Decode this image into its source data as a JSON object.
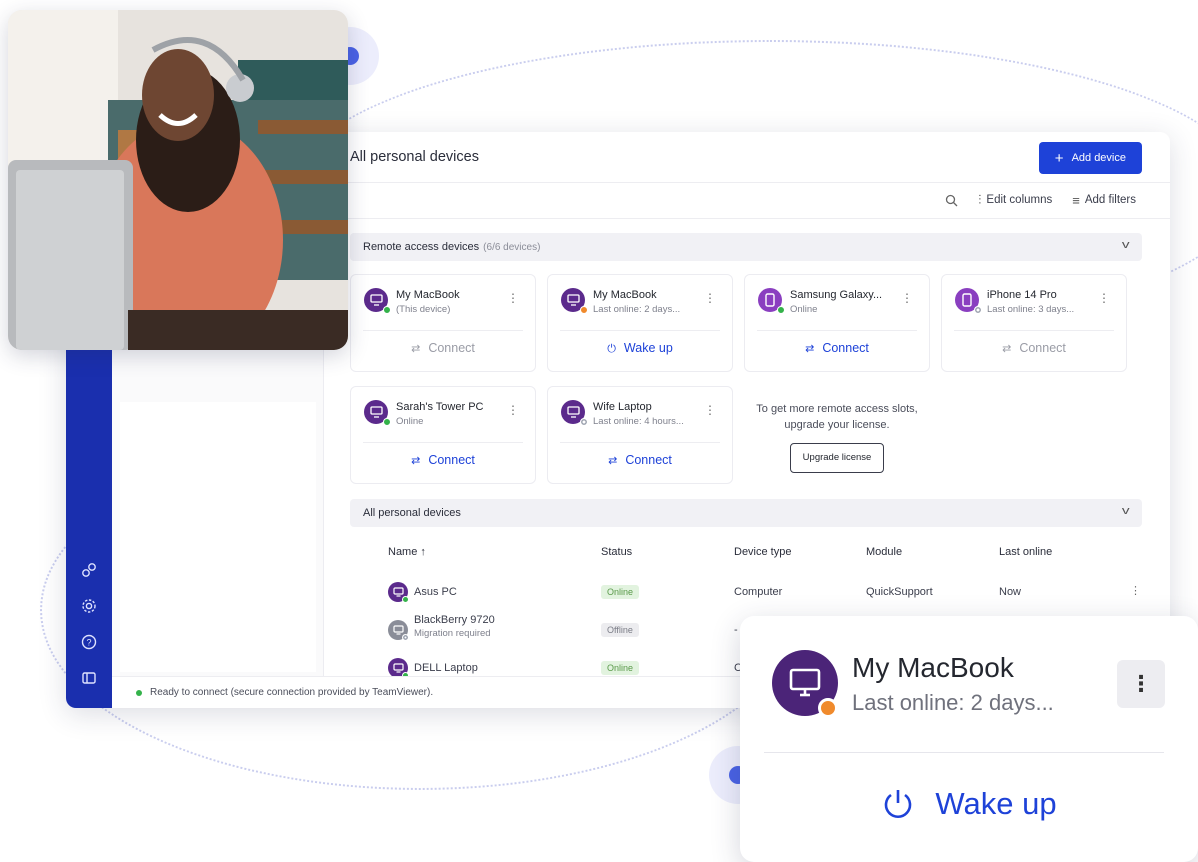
{
  "window": {
    "page_title": "All personal devices",
    "add_device_label": "Add device",
    "toolbar": {
      "edit_columns": "Edit columns",
      "add_filters": "Add filters"
    },
    "remote_section": {
      "title": "Remote access devices",
      "count": "(6/6 devices)"
    },
    "remote_devices": [
      {
        "name": "My MacBook",
        "sub": "(This device)",
        "status": "online",
        "action": "Connect",
        "action_state": "disabled",
        "kind": "computer"
      },
      {
        "name": "My MacBook",
        "sub": "Last online: 2 days...",
        "status": "away",
        "action": "Wake up",
        "action_state": "active",
        "kind": "computer"
      },
      {
        "name": "Samsung Galaxy...",
        "sub": "Online",
        "status": "online",
        "action": "Connect",
        "action_state": "active",
        "kind": "phone"
      },
      {
        "name": "iPhone 14 Pro",
        "sub": "Last online: 3 days...",
        "status": "offline",
        "action": "Connect",
        "action_state": "disabled",
        "kind": "phone"
      },
      {
        "name": "Sarah's Tower PC",
        "sub": "Online",
        "status": "online",
        "action": "Connect",
        "action_state": "active",
        "kind": "computer"
      },
      {
        "name": "Wife Laptop",
        "sub": "Last online: 4 hours...",
        "status": "offline",
        "action": "Connect",
        "action_state": "active",
        "kind": "computer"
      }
    ],
    "upgrade": {
      "text": "To get more remote access slots, upgrade your license.",
      "button": "Upgrade license"
    },
    "all_section": {
      "title": "All personal devices"
    },
    "table": {
      "columns": [
        "Name",
        "Status",
        "Device type",
        "Module",
        "Last online"
      ],
      "sort_indicator": "↑",
      "rows": [
        {
          "name": "Asus PC",
          "sub": "",
          "status": "Online",
          "type": "Computer",
          "module": "QuickSupport",
          "last": "Now"
        },
        {
          "name": "BlackBerry 9720",
          "sub": "Migration required",
          "status": "Offline",
          "type": "-",
          "module": "",
          "last": ""
        },
        {
          "name": "DELL Laptop",
          "sub": "",
          "status": "Online",
          "type": "C",
          "module": "",
          "last": ""
        }
      ]
    },
    "statusbar": "Ready to connect (secure connection provided by TeamViewer).",
    "sidebar_icons": [
      "connections-icon",
      "settings-icon",
      "help-icon",
      "panel-icon"
    ]
  },
  "zoom_card": {
    "name": "My MacBook",
    "sub": "Last online: 2 days...",
    "action": "Wake up"
  },
  "colors": {
    "accent": "#1e42d8",
    "sidebar": "#1a2fae",
    "device_purple": "#5b2a8c",
    "online": "#34b24a",
    "away": "#f08a2c"
  }
}
